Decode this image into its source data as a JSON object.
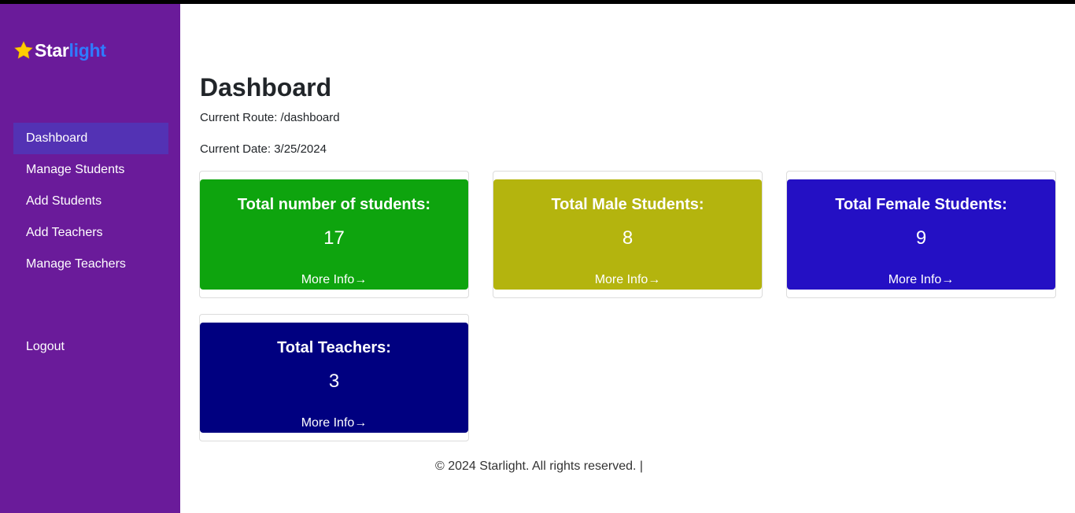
{
  "brand": {
    "part1": "Star",
    "part2": "light",
    "accent": "#2f7bff",
    "icon": "star-icon"
  },
  "sidebar": {
    "bg_color": "#6a1b9a",
    "items": [
      {
        "label": "Dashboard",
        "active": true
      },
      {
        "label": "Manage Students",
        "active": false
      },
      {
        "label": "Add Students",
        "active": false
      },
      {
        "label": "Add Teachers",
        "active": false
      },
      {
        "label": "Manage Teachers",
        "active": false
      }
    ],
    "logout": "Logout"
  },
  "main": {
    "title": "Dashboard",
    "route": "Current Route: /dashboard",
    "date": "Current Date: 3/25/2024"
  },
  "cards": [
    {
      "title": "Total number of students:",
      "value": "17",
      "more": "More Info→",
      "color": "#0ea40e"
    },
    {
      "title": "Total Male Students:",
      "value": "8",
      "more": "More Info→",
      "color": "#b4b40e"
    },
    {
      "title": "Total Female Students:",
      "value": "9",
      "more": "More Info→",
      "color": "#2410c4"
    },
    {
      "title": "Total Teachers:",
      "value": "3",
      "more": "More Info→",
      "color": "#000080"
    }
  ],
  "footer": {
    "text": "© 2024 Starlight. All rights reserved. |"
  }
}
